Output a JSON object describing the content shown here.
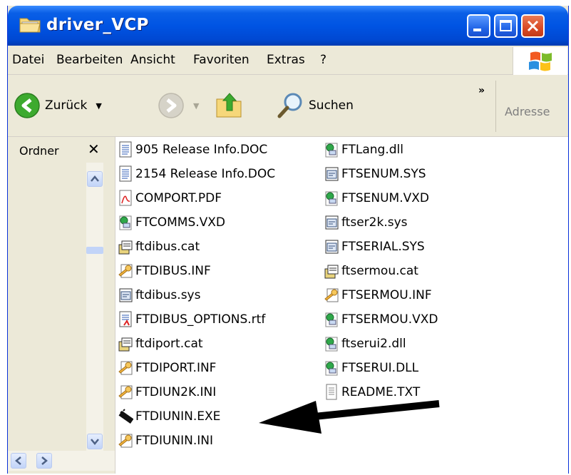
{
  "window": {
    "title": "driver_VCP"
  },
  "menu": [
    "Datei",
    "Bearbeiten",
    "Ansicht",
    "Favoriten",
    "Extras",
    "?"
  ],
  "toolbar": {
    "back_label": "Zurück",
    "search_label": "Suchen",
    "more": "»",
    "address_label": "Adresse"
  },
  "folder_pane": {
    "title": "Ordner",
    "close": "✕"
  },
  "files_col1": [
    {
      "name": "905 Release Info.DOC",
      "icon": "doc"
    },
    {
      "name": "2154 Release Info.DOC",
      "icon": "doc"
    },
    {
      "name": "COMPORT.PDF",
      "icon": "pdf"
    },
    {
      "name": "FTCOMMS.VXD",
      "icon": "vxd"
    },
    {
      "name": "ftdibus.cat",
      "icon": "cat"
    },
    {
      "name": "FTDIBUS.INF",
      "icon": "inf"
    },
    {
      "name": "ftdibus.sys",
      "icon": "sys"
    },
    {
      "name": "FTDIBUS_OPTIONS.rtf",
      "icon": "rtf"
    },
    {
      "name": "ftdiport.cat",
      "icon": "cat"
    },
    {
      "name": "FTDIPORT.INF",
      "icon": "inf"
    },
    {
      "name": "FTDIUN2K.INI",
      "icon": "inf"
    },
    {
      "name": "FTDIUNIN.EXE",
      "icon": "exe"
    },
    {
      "name": "FTDIUNIN.INI",
      "icon": "inf"
    }
  ],
  "files_col2": [
    {
      "name": "FTLang.dll",
      "icon": "vxd"
    },
    {
      "name": "FTSENUM.SYS",
      "icon": "sys"
    },
    {
      "name": "FTSENUM.VXD",
      "icon": "vxd"
    },
    {
      "name": "ftser2k.sys",
      "icon": "sys"
    },
    {
      "name": "FTSERIAL.SYS",
      "icon": "sys"
    },
    {
      "name": "ftsermou.cat",
      "icon": "cat"
    },
    {
      "name": "FTSERMOU.INF",
      "icon": "inf"
    },
    {
      "name": "FTSERMOU.VXD",
      "icon": "vxd"
    },
    {
      "name": "ftserui2.dll",
      "icon": "vxd"
    },
    {
      "name": "FTSERUI.DLL",
      "icon": "vxd"
    },
    {
      "name": "README.TXT",
      "icon": "txt"
    }
  ],
  "colors": {
    "titlebar": "#0054E3",
    "close_button": "#D94A26",
    "arrow": "#000000"
  }
}
